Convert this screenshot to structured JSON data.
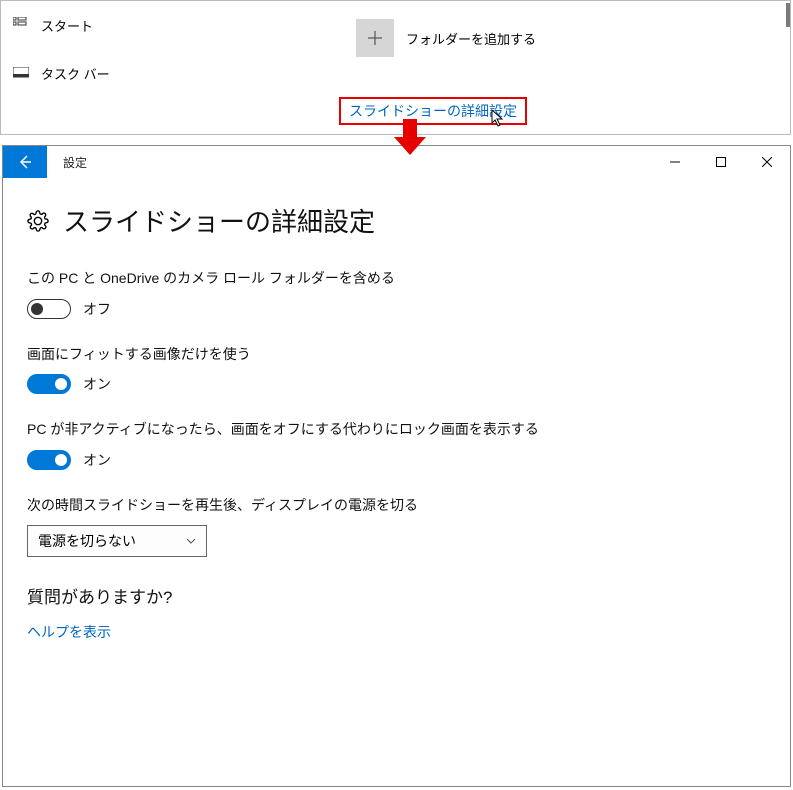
{
  "top": {
    "nav": [
      {
        "label": "スタート",
        "icon": "start-icon"
      },
      {
        "label": "タスク バー",
        "icon": "taskbar-icon"
      }
    ],
    "add_folder_label": "フォルダーを追加する",
    "slideshow_link": "スライドショーの詳細設定"
  },
  "window": {
    "title": "設定",
    "page_title": "スライドショーの詳細設定",
    "settings": [
      {
        "label": "この PC と OneDrive のカメラ ロール フォルダーを含める",
        "state_text": "オフ",
        "on": false
      },
      {
        "label": "画面にフィットする画像だけを使う",
        "state_text": "オン",
        "on": true
      },
      {
        "label": "PC が非アクティブになったら、画面をオフにする代わりにロック画面を表示する",
        "state_text": "オン",
        "on": true
      }
    ],
    "dropdown": {
      "label": "次の時間スライドショーを再生後、ディスプレイの電源を切る",
      "value": "電源を切らない"
    },
    "question_heading": "質問がありますか?",
    "help_link": "ヘルプを表示"
  },
  "colors": {
    "accent": "#0078d7",
    "link": "#0067c0",
    "highlight_border": "#e60000"
  }
}
